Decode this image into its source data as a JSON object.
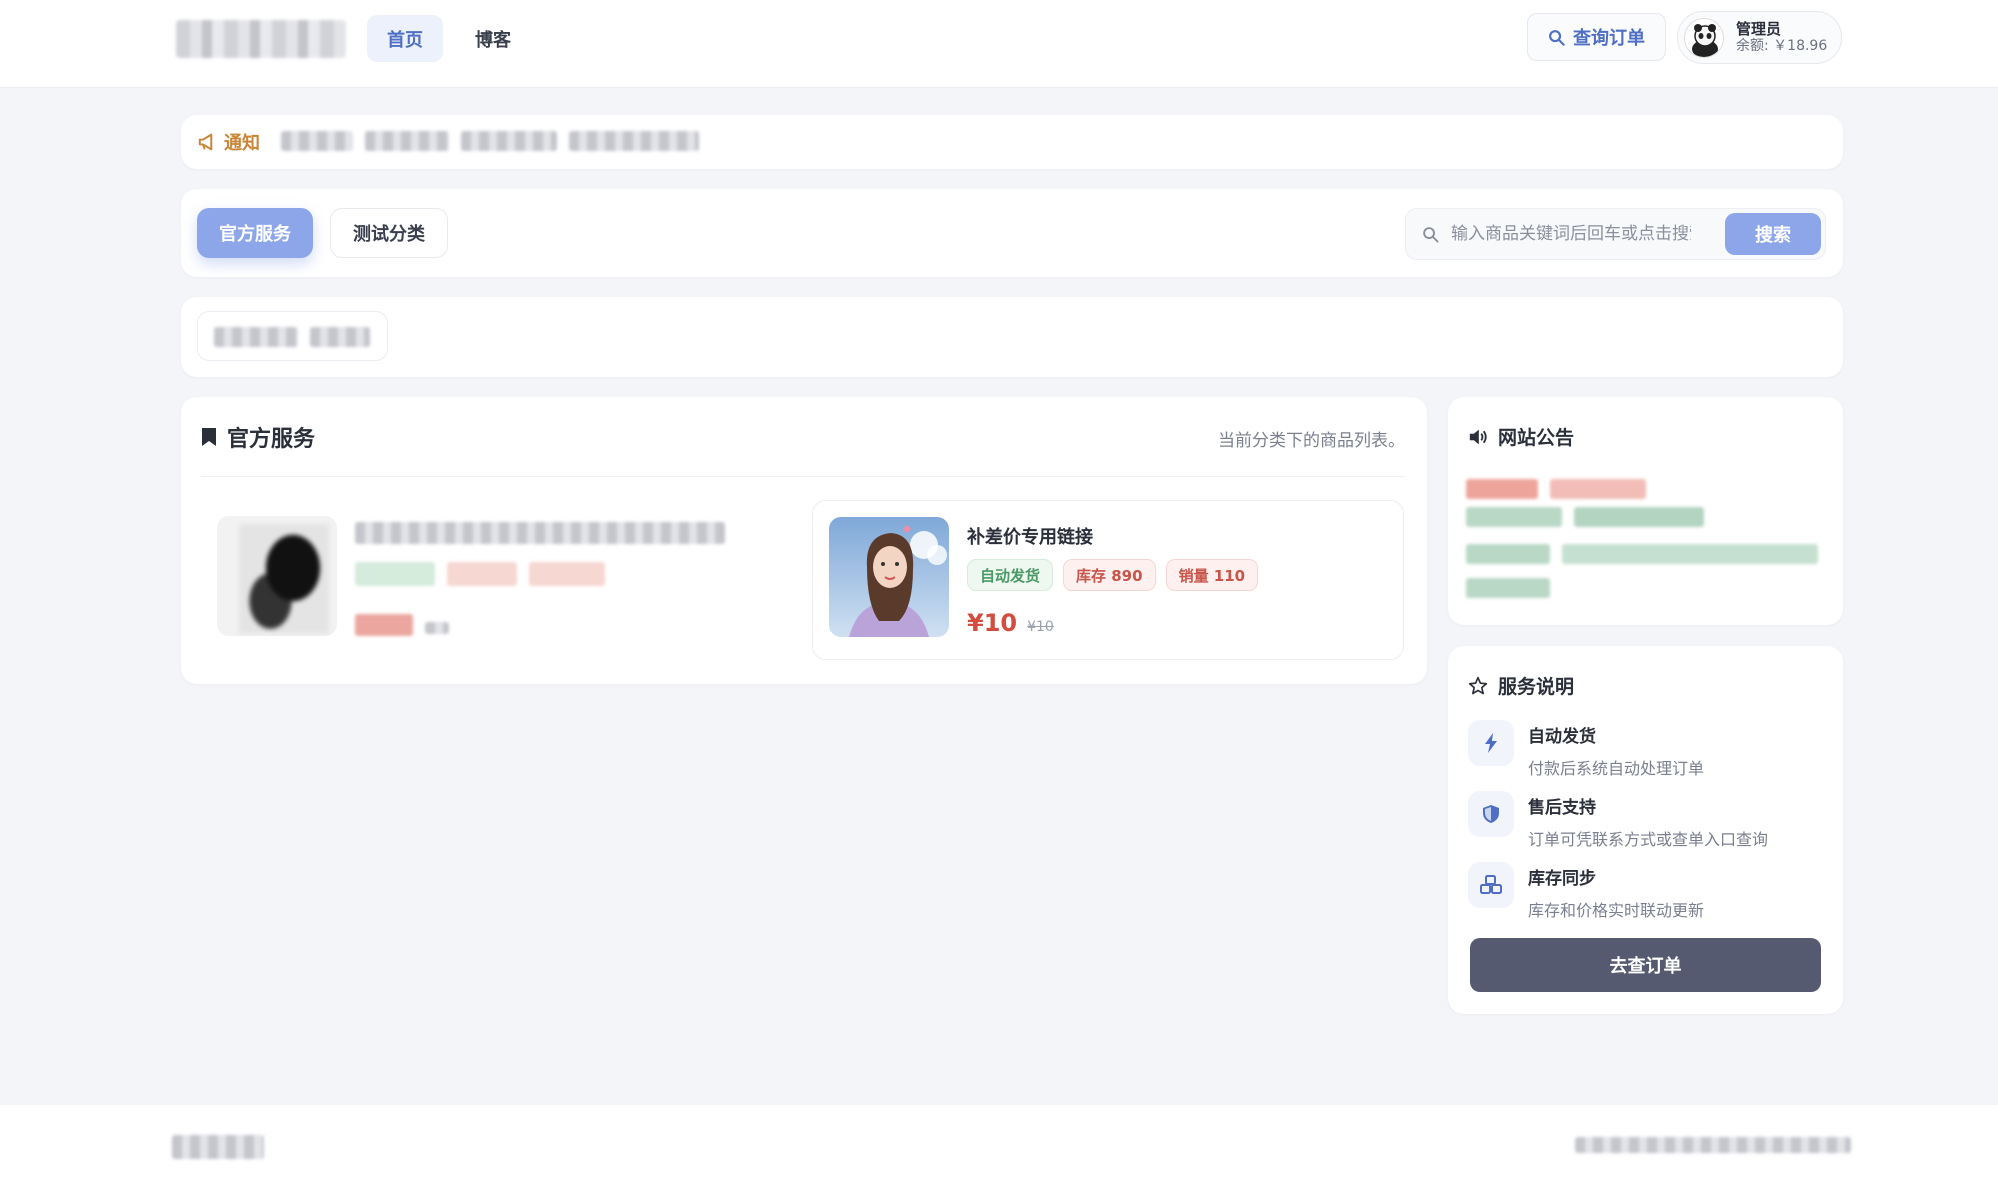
{
  "header": {
    "nav": [
      {
        "label": "首页",
        "active": true
      },
      {
        "label": "博客",
        "active": false
      }
    ],
    "query_order_label": "查询订单",
    "user": {
      "name": "管理员",
      "balance": "余额: ￥18.96"
    }
  },
  "notice": {
    "label": "通知"
  },
  "categories": [
    {
      "label": "官方服务",
      "active": true
    },
    {
      "label": "测试分类",
      "active": false
    }
  ],
  "search": {
    "placeholder": "输入商品关键词后回车或点击搜索",
    "button": "搜索"
  },
  "main": {
    "title": "官方服务",
    "hint": "当前分类下的商品列表。",
    "products": [
      {
        "title": "补差价专用链接",
        "tags": [
          "自动发货",
          "库存 890",
          "销量 110"
        ],
        "price": "¥10",
        "old_price": "¥10"
      }
    ]
  },
  "announcement": {
    "title": "网站公告"
  },
  "service": {
    "title": "服务说明",
    "features": [
      {
        "icon": "bolt-icon",
        "title": "自动发货",
        "desc": "付款后系统自动处理订单"
      },
      {
        "icon": "shield-icon",
        "title": "售后支持",
        "desc": "订单可凭联系方式或查单入口查询"
      },
      {
        "icon": "cubes-icon",
        "title": "库存同步",
        "desc": "库存和价格实时联动更新"
      }
    ],
    "button": "去查订单"
  },
  "colors": {
    "accent": "#8da6ea",
    "nav_active": "#4e6fc4",
    "price": "#d24d3f",
    "dark_button": "#565a70"
  }
}
